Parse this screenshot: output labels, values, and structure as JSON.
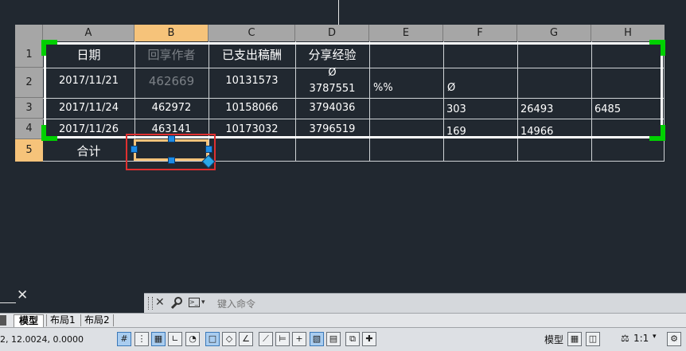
{
  "sheet": {
    "columns": [
      "A",
      "B",
      "C",
      "D",
      "E",
      "F",
      "G",
      "H"
    ],
    "rows": [
      "1",
      "2",
      "3",
      "4",
      "5"
    ],
    "cells": {
      "r1": {
        "a": "日期",
        "b": "回享作者",
        "c": "已支出稿酬",
        "d": "分享经验"
      },
      "r2": {
        "a": "2017/11/21",
        "b": "462669",
        "c": "10131573",
        "d_sym": "Ø",
        "d": "3787551",
        "e": "%%",
        "f": "Ø"
      },
      "r3": {
        "a": "2017/11/24",
        "b": "462972",
        "c": "10158066",
        "d": "3794036",
        "f": "303",
        "g": "26493",
        "h": "6485"
      },
      "r4": {
        "a": "2017/11/26",
        "b": "463141",
        "c": "10173032",
        "d": "3796519",
        "f": "169",
        "g": "14966"
      },
      "r5": {
        "a": "合计"
      }
    },
    "colors": {
      "selected_header": "#f6c37a",
      "grip": "#00d000",
      "cell_highlight": "#e03030",
      "handle": "#1e8ce6"
    }
  },
  "viewport": {
    "close_glyph": "✕"
  },
  "command_bar": {
    "close_icon": "✕",
    "wrench_icon": "wrench-icon",
    "prompt_icon": "prompt-icon",
    "placeholder": "键入命令"
  },
  "layout_tabs": [
    {
      "label": "模型",
      "active": true
    },
    {
      "label": "布局1"
    },
    {
      "label": "布局2"
    }
  ],
  "status_bar": {
    "coords": "2, 12.0024, 0.0000",
    "model_label": "模型",
    "scale_label": "1:1"
  }
}
